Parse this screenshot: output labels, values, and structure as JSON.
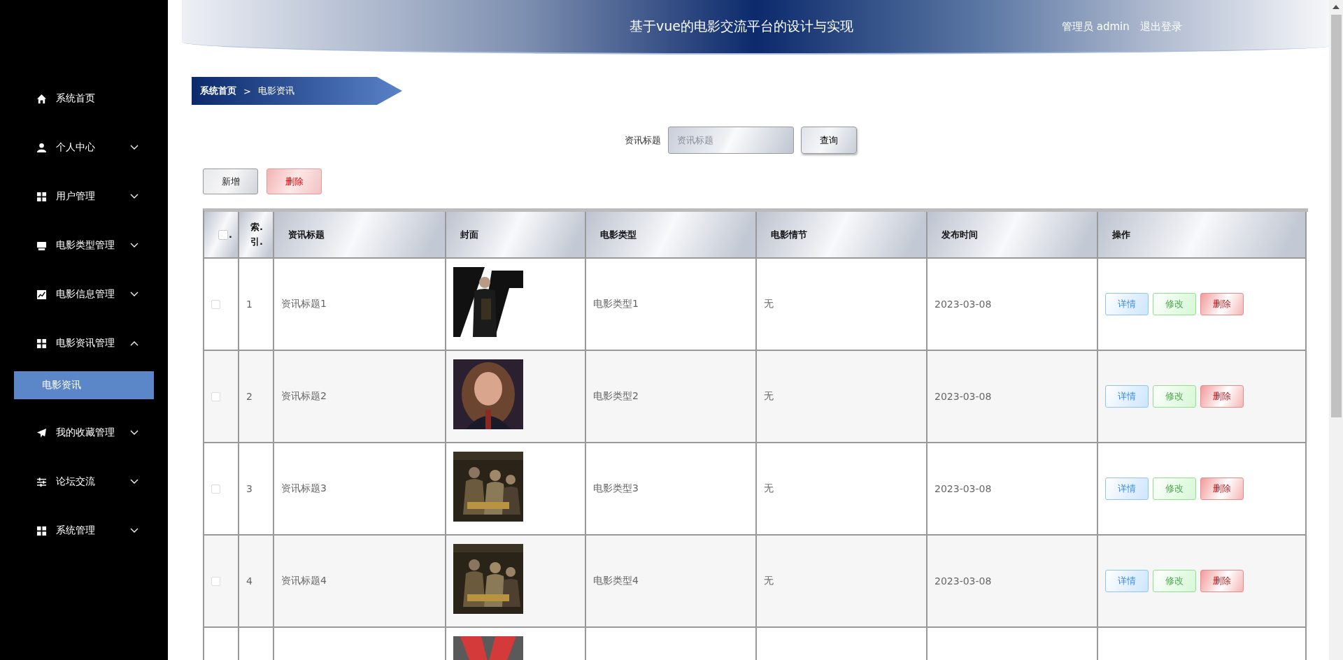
{
  "sidebar": {
    "items": [
      {
        "label": "系统首页"
      },
      {
        "label": "个人中心",
        "expanded": false
      },
      {
        "label": "用户管理",
        "expanded": false
      },
      {
        "label": "电影类型管理",
        "expanded": false
      },
      {
        "label": "电影信息管理",
        "expanded": false
      },
      {
        "label": "电影资讯管理",
        "expanded": true,
        "children": [
          {
            "label": "电影资讯",
            "selected": true
          }
        ]
      },
      {
        "label": "我的收藏管理",
        "expanded": false
      },
      {
        "label": "论坛交流",
        "expanded": false
      },
      {
        "label": "系统管理",
        "expanded": false
      }
    ]
  },
  "header": {
    "title": "基于vue的电影交流平台的设计与实现",
    "user": "管理员 admin",
    "logout": "退出登录"
  },
  "breadcrumb": {
    "items": [
      "系统首页",
      "电影资讯"
    ],
    "separator": ">"
  },
  "search": {
    "label": "资讯标题",
    "placeholder": "资讯标题",
    "button": "查询"
  },
  "actions": [
    "新增",
    "删除"
  ],
  "table": {
    "select_all": {
      "checked": false,
      "mark": "."
    },
    "columns": [
      "索.引.",
      "资讯标题",
      "封面",
      "电影类型",
      "电影情节",
      "发布时间",
      "操作"
    ],
    "rows": [
      {
        "checked": false,
        "index": "1",
        "title": "资讯标题1",
        "cover": {
          "kind": "picture"
        },
        "type": "电影类型1",
        "plot": "无",
        "time": "2023-03-08",
        "buttons": [
          "详情",
          "修改",
          "删除"
        ]
      },
      {
        "checked": false,
        "index": "2",
        "title": "资讯标题2",
        "cover": {
          "kind": "picture"
        },
        "type": "电影类型2",
        "plot": "无",
        "time": "2023-03-08",
        "buttons": [
          "详情",
          "修改",
          "删除"
        ]
      },
      {
        "checked": false,
        "index": "3",
        "title": "资讯标题3",
        "cover": {
          "kind": "picture"
        },
        "type": "电影类型3",
        "plot": "无",
        "time": "2023-03-08",
        "buttons": [
          "详情",
          "修改",
          "删除"
        ]
      },
      {
        "checked": false,
        "index": "4",
        "title": "资讯标题4",
        "cover": {
          "kind": "picture"
        },
        "type": "电影类型4",
        "plot": "无",
        "time": "2023-03-08",
        "buttons": [
          "详情",
          "修改",
          "删除"
        ]
      },
      {
        "cover": {
          "kind": "picture"
        }
      }
    ]
  }
}
